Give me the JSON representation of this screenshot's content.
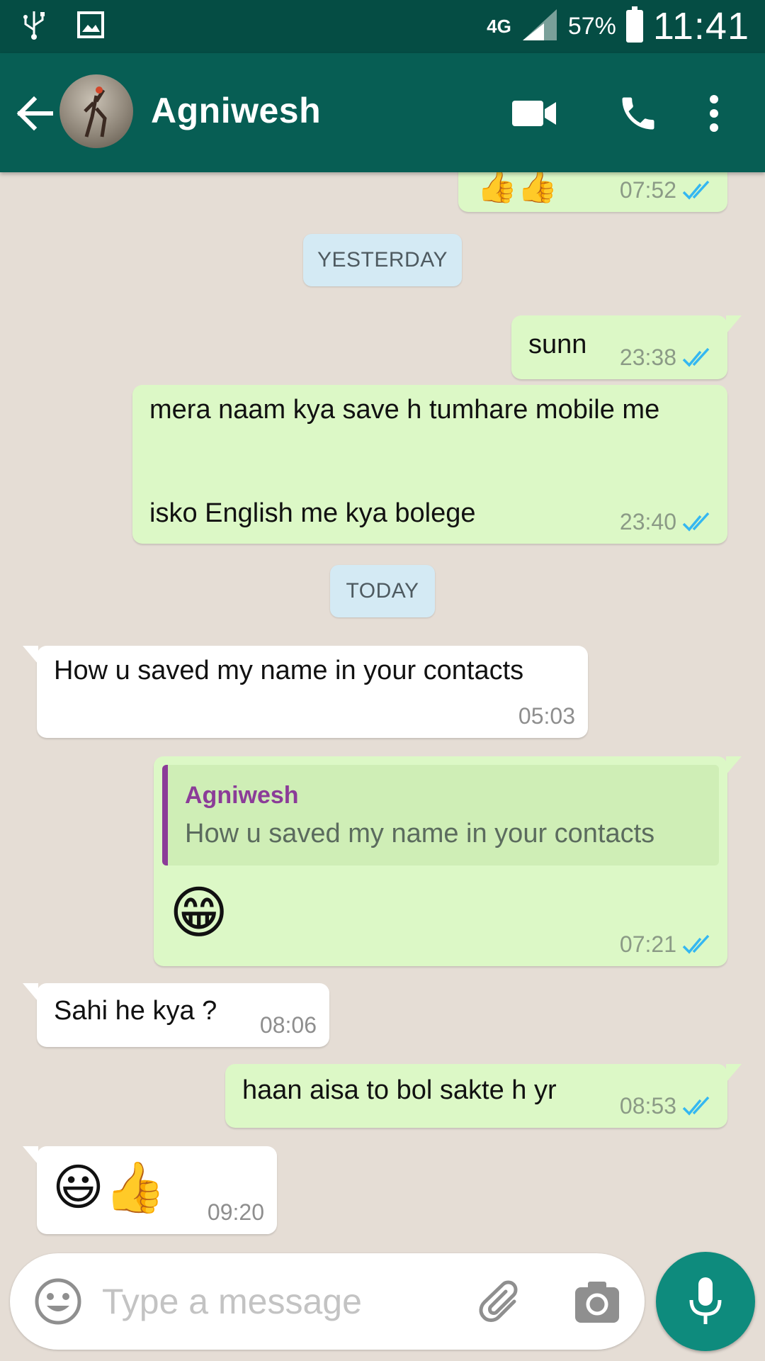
{
  "status_bar": {
    "network": "4G",
    "battery": "57%",
    "time": "11:41",
    "icons": [
      "usb-icon",
      "image-icon",
      "signal-icon",
      "battery-charging-icon"
    ]
  },
  "header": {
    "contact_name": "Agniwesh",
    "icons": [
      "back-arrow-icon",
      "video-call-icon",
      "phone-call-icon",
      "more-options-icon"
    ]
  },
  "chat": {
    "days": {
      "yesterday": "YESTERDAY",
      "today": "TODAY"
    },
    "messages": {
      "m0": {
        "time": "07:52",
        "content": "thumbs up emojis (partially visible)"
      },
      "m1": {
        "text": "sunn",
        "time": "23:38"
      },
      "m2": {
        "line1": "mera naam kya save h tumhare mobile me",
        "line2": "isko English me kya bolege",
        "time": "23:40"
      },
      "m3": {
        "text": "How u saved my name in your contacts",
        "time": "05:03"
      },
      "m4": {
        "quote_author": "Agniwesh",
        "quote_text": "How u saved my name in your contacts",
        "emoji": "😁",
        "time": "07:21"
      },
      "m5": {
        "text": "Sahi he kya ?",
        "time": "08:06"
      },
      "m6": {
        "text": "haan aisa  to bol sakte h yr",
        "time": "08:53"
      },
      "m7": {
        "emoji": "😃👍",
        "time": "09:20"
      }
    }
  },
  "composer": {
    "placeholder": "Type a message",
    "icons": [
      "emoji-icon",
      "attach-icon",
      "camera-icon",
      "mic-icon"
    ]
  },
  "colors": {
    "status_bar": "#054d44",
    "app_bar": "#075e54",
    "chat_bg": "#e5ddd5",
    "outgoing": "#dcf8c6",
    "incoming": "#ffffff",
    "read_tick": "#34b7f1",
    "fab": "#0e8b7d",
    "quote_accent": "#8b3c98"
  }
}
